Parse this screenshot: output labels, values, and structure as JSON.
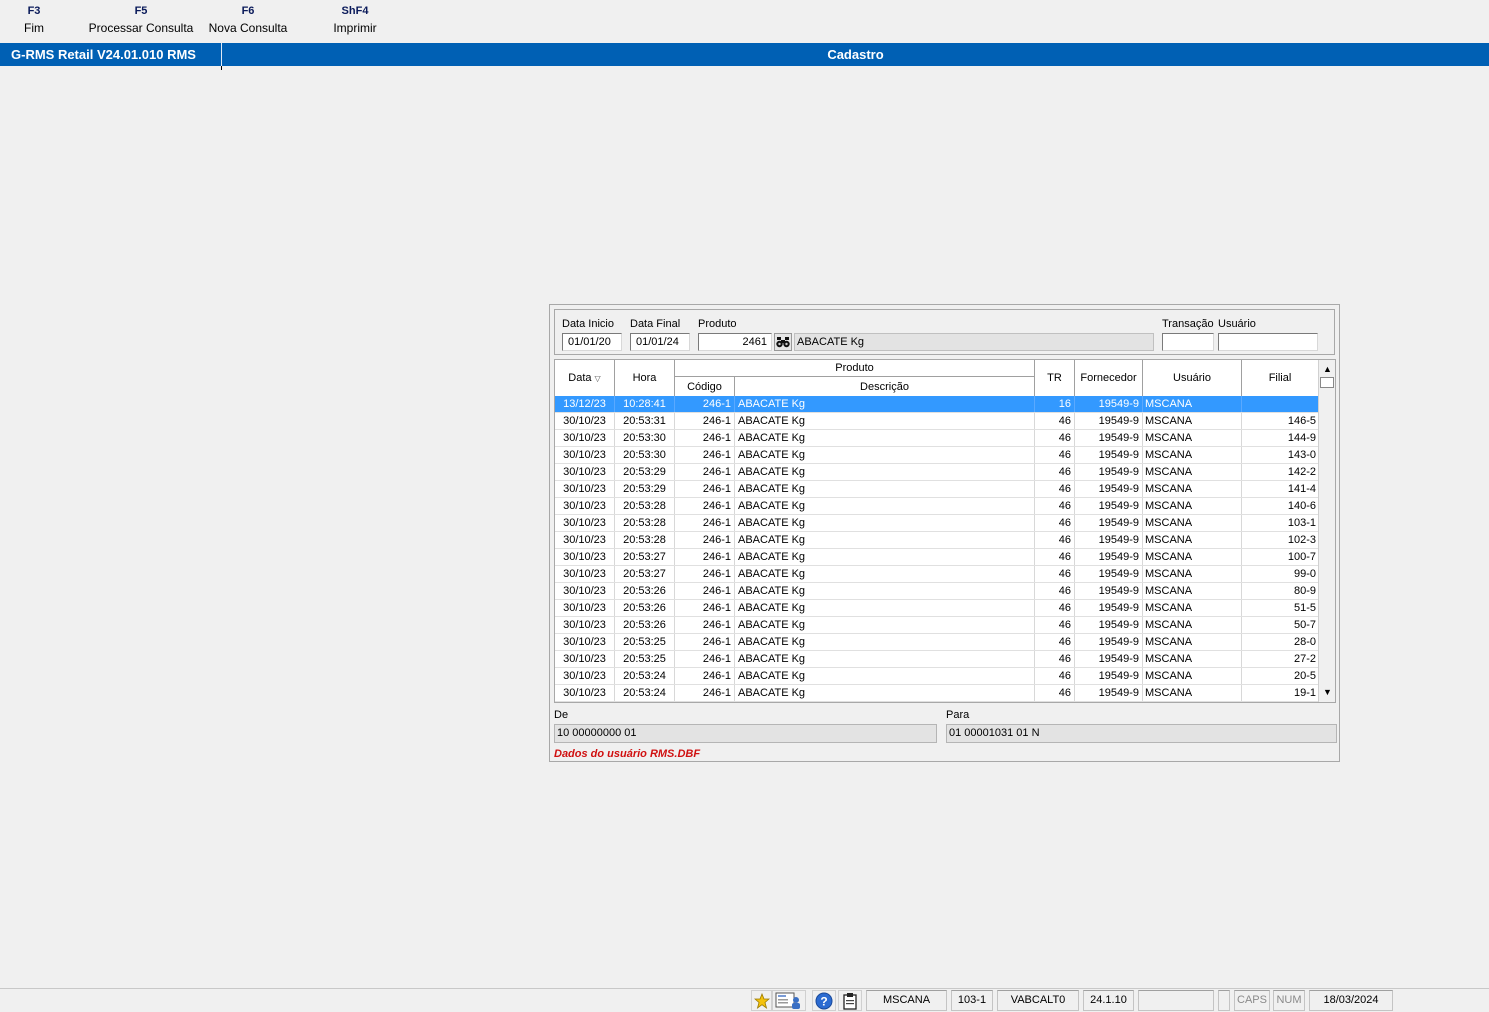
{
  "toolbar": {
    "keys": [
      {
        "key": "F3",
        "label": "Fim"
      },
      {
        "key": "F5",
        "label": "Processar Consulta"
      },
      {
        "key": "F6",
        "label": "Nova Consulta"
      },
      {
        "key": "ShF4",
        "label": "Imprimir"
      }
    ]
  },
  "titlebar": {
    "app_name": "G-RMS Retail V24.01.010 RMS",
    "screen_title": "Cadastro"
  },
  "colors": {
    "title_bar": "#0060b4",
    "selection": "#3399ff",
    "message": "#d01010"
  },
  "filters": {
    "data_inicio_label": "Data Inicio",
    "data_inicio_value": "01/01/20",
    "data_final_label": "Data Final",
    "data_final_value": "01/01/24",
    "produto_label": "Produto",
    "produto_code": "2461",
    "produto_search_icon": "binoculars-icon",
    "produto_desc": "ABACATE Kg",
    "transacao_label": "Transação",
    "transacao_value": "",
    "usuario_label": "Usuário",
    "usuario_value": ""
  },
  "grid": {
    "headers": {
      "data": "Data",
      "hora": "Hora",
      "produto": "Produto",
      "codigo": "Código",
      "descricao": "Descrição",
      "tr": "TR",
      "fornecedor": "Fornecedor",
      "usuario": "Usuário",
      "filial": "Filial"
    },
    "sort_icon": "sort-descending-icon",
    "selected_row": 0,
    "rows": [
      {
        "data": "13/12/23",
        "hora": "10:28:41",
        "codigo": "246-1",
        "descricao": "ABACATE Kg",
        "tr": "16",
        "fornecedor": "19549-9",
        "usuario": "MSCANA",
        "filial": ""
      },
      {
        "data": "30/10/23",
        "hora": "20:53:31",
        "codigo": "246-1",
        "descricao": "ABACATE Kg",
        "tr": "46",
        "fornecedor": "19549-9",
        "usuario": "MSCANA",
        "filial": "146-5"
      },
      {
        "data": "30/10/23",
        "hora": "20:53:30",
        "codigo": "246-1",
        "descricao": "ABACATE Kg",
        "tr": "46",
        "fornecedor": "19549-9",
        "usuario": "MSCANA",
        "filial": "144-9"
      },
      {
        "data": "30/10/23",
        "hora": "20:53:30",
        "codigo": "246-1",
        "descricao": "ABACATE Kg",
        "tr": "46",
        "fornecedor": "19549-9",
        "usuario": "MSCANA",
        "filial": "143-0"
      },
      {
        "data": "30/10/23",
        "hora": "20:53:29",
        "codigo": "246-1",
        "descricao": "ABACATE Kg",
        "tr": "46",
        "fornecedor": "19549-9",
        "usuario": "MSCANA",
        "filial": "142-2"
      },
      {
        "data": "30/10/23",
        "hora": "20:53:29",
        "codigo": "246-1",
        "descricao": "ABACATE Kg",
        "tr": "46",
        "fornecedor": "19549-9",
        "usuario": "MSCANA",
        "filial": "141-4"
      },
      {
        "data": "30/10/23",
        "hora": "20:53:28",
        "codigo": "246-1",
        "descricao": "ABACATE Kg",
        "tr": "46",
        "fornecedor": "19549-9",
        "usuario": "MSCANA",
        "filial": "140-6"
      },
      {
        "data": "30/10/23",
        "hora": "20:53:28",
        "codigo": "246-1",
        "descricao": "ABACATE Kg",
        "tr": "46",
        "fornecedor": "19549-9",
        "usuario": "MSCANA",
        "filial": "103-1"
      },
      {
        "data": "30/10/23",
        "hora": "20:53:28",
        "codigo": "246-1",
        "descricao": "ABACATE Kg",
        "tr": "46",
        "fornecedor": "19549-9",
        "usuario": "MSCANA",
        "filial": "102-3"
      },
      {
        "data": "30/10/23",
        "hora": "20:53:27",
        "codigo": "246-1",
        "descricao": "ABACATE Kg",
        "tr": "46",
        "fornecedor": "19549-9",
        "usuario": "MSCANA",
        "filial": "100-7"
      },
      {
        "data": "30/10/23",
        "hora": "20:53:27",
        "codigo": "246-1",
        "descricao": "ABACATE Kg",
        "tr": "46",
        "fornecedor": "19549-9",
        "usuario": "MSCANA",
        "filial": "99-0"
      },
      {
        "data": "30/10/23",
        "hora": "20:53:26",
        "codigo": "246-1",
        "descricao": "ABACATE Kg",
        "tr": "46",
        "fornecedor": "19549-9",
        "usuario": "MSCANA",
        "filial": "80-9"
      },
      {
        "data": "30/10/23",
        "hora": "20:53:26",
        "codigo": "246-1",
        "descricao": "ABACATE Kg",
        "tr": "46",
        "fornecedor": "19549-9",
        "usuario": "MSCANA",
        "filial": "51-5"
      },
      {
        "data": "30/10/23",
        "hora": "20:53:26",
        "codigo": "246-1",
        "descricao": "ABACATE Kg",
        "tr": "46",
        "fornecedor": "19549-9",
        "usuario": "MSCANA",
        "filial": "50-7"
      },
      {
        "data": "30/10/23",
        "hora": "20:53:25",
        "codigo": "246-1",
        "descricao": "ABACATE Kg",
        "tr": "46",
        "fornecedor": "19549-9",
        "usuario": "MSCANA",
        "filial": "28-0"
      },
      {
        "data": "30/10/23",
        "hora": "20:53:25",
        "codigo": "246-1",
        "descricao": "ABACATE Kg",
        "tr": "46",
        "fornecedor": "19549-9",
        "usuario": "MSCANA",
        "filial": "27-2"
      },
      {
        "data": "30/10/23",
        "hora": "20:53:24",
        "codigo": "246-1",
        "descricao": "ABACATE Kg",
        "tr": "46",
        "fornecedor": "19549-9",
        "usuario": "MSCANA",
        "filial": "20-5"
      },
      {
        "data": "30/10/23",
        "hora": "20:53:24",
        "codigo": "246-1",
        "descricao": "ABACATE Kg",
        "tr": "46",
        "fornecedor": "19549-9",
        "usuario": "MSCANA",
        "filial": "19-1"
      }
    ]
  },
  "detail": {
    "de_label": "De",
    "de_value": "10 00000000 01",
    "para_label": "Para",
    "para_value": "01 00001031 01 N",
    "message": "Dados do usuário RMS.DBF"
  },
  "statusbar": {
    "icons": [
      "favorites-star-icon",
      "user-card-icon",
      "help-icon",
      "clipboard-icon"
    ],
    "user": "MSCANA",
    "filial": "103-1",
    "program": "VABCALT0",
    "version": "24.1.10",
    "caps": "CAPS",
    "num": "NUM",
    "date": "18/03/2024"
  }
}
